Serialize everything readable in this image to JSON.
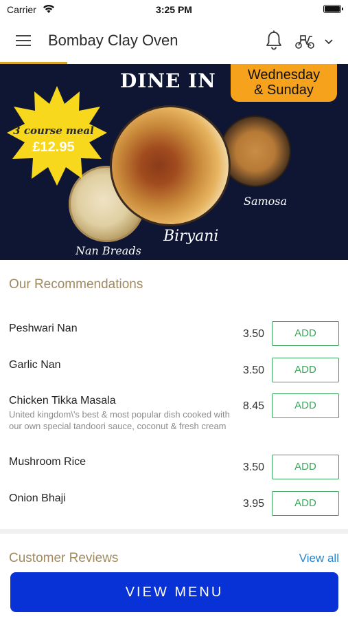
{
  "status_bar": {
    "carrier": "Carrier",
    "time": "3:25 PM"
  },
  "header": {
    "title": "Bombay Clay Oven"
  },
  "banner": {
    "title": "DINE IN",
    "days_line1": "Wednesday",
    "days_line2": "& Sunday",
    "offer": "3 course meal",
    "price": "£12.95",
    "labels": {
      "samosa": "Samosa",
      "biryani": "Biryani",
      "nan": "Nan Breads"
    }
  },
  "recommendations": {
    "title": "Our Recommendations",
    "add_label": "ADD",
    "items": [
      {
        "name": "Peshwari Nan",
        "price": "3.50",
        "description": ""
      },
      {
        "name": "Garlic Nan",
        "price": "3.50",
        "description": ""
      },
      {
        "name": "Chicken Tikka Masala",
        "price": "8.45",
        "description": "United kingdom\\'s best & most popular dish cooked with our own special tandoori sauce, coconut & fresh cream"
      },
      {
        "name": "Mushroom Rice",
        "price": "3.50",
        "description": ""
      },
      {
        "name": "Onion Bhaji",
        "price": "3.95",
        "description": ""
      }
    ]
  },
  "reviews": {
    "title": "Customer Reviews",
    "view_all": "View all"
  },
  "cta": {
    "label": "VIEW MENU"
  },
  "colors": {
    "accent": "#d7a62a",
    "add_green": "#3aa55a",
    "primary_blue": "#0831d6",
    "banner_bg": "#0f1633",
    "section_title": "#a08a60",
    "link": "#2b83c8"
  },
  "icons": [
    "wifi-icon",
    "battery-icon",
    "hamburger-menu-icon",
    "bell-icon",
    "scooter-icon",
    "chevron-down-icon"
  ]
}
